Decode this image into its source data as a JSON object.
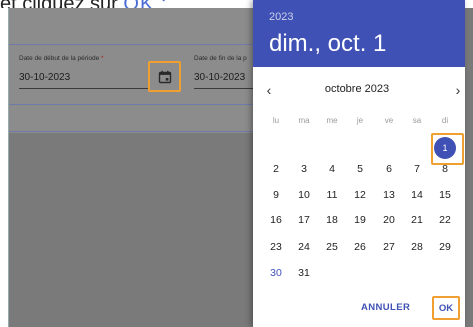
{
  "instruction": {
    "text": "et cliquez sur ",
    "ok_word": "OK :"
  },
  "form": {
    "start_label": "Date de début de la période",
    "required_mark": "*",
    "start_value": "30-10-2023",
    "end_label": "Date de fin de la p",
    "end_value": "30-10-2023",
    "calendar_icon": "calendar-icon"
  },
  "picker": {
    "year": "2023",
    "selected_date": "dim., oct. 1",
    "month_label": "octobre 2023",
    "prev_icon": "chevron-left-icon",
    "next_icon": "chevron-right-icon",
    "weekdays": [
      "lu",
      "ma",
      "me",
      "je",
      "ve",
      "sa",
      "di"
    ],
    "weeks": [
      [
        "",
        "",
        "",
        "",
        "",
        "",
        "1"
      ],
      [
        "2",
        "3",
        "4",
        "5",
        "6",
        "7",
        "8"
      ],
      [
        "9",
        "10",
        "11",
        "12",
        "13",
        "14",
        "15"
      ],
      [
        "16",
        "17",
        "18",
        "19",
        "20",
        "21",
        "22"
      ],
      [
        "23",
        "24",
        "25",
        "26",
        "27",
        "28",
        "29"
      ],
      [
        "30",
        "31",
        "",
        "",
        "",
        "",
        ""
      ]
    ],
    "selected_day": "1",
    "today_day": "30",
    "cancel_label": "ANNULER",
    "ok_label": "OK"
  },
  "colors": {
    "accent": "#3f51b5",
    "highlight": "#f0a030",
    "overlay": "#7a7a7a"
  }
}
